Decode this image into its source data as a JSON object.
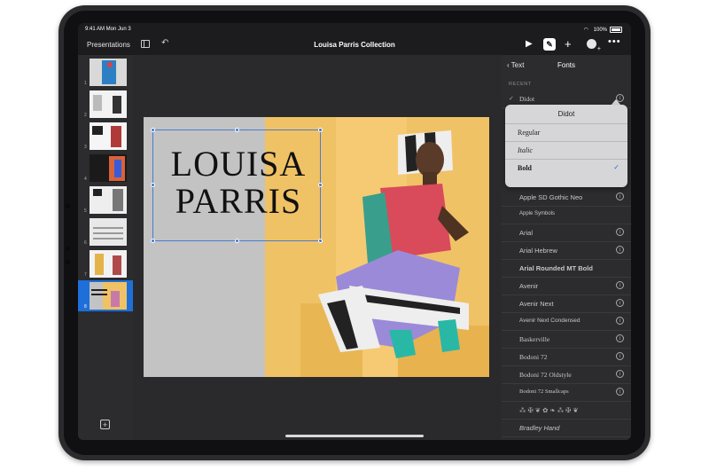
{
  "status_bar": {
    "time": "9:41 AM  Mon Jun 3",
    "battery": "100%"
  },
  "toolbar": {
    "back_label": "Presentations",
    "title": "Louisa Parris Collection",
    "play_icon": "play-icon",
    "format_icon": "paintbrush-icon",
    "add_icon": "plus-icon",
    "collaborate_icon": "collaborate-icon",
    "more_icon": "more-icon"
  },
  "navigator": {
    "slides": [
      {
        "number": "1"
      },
      {
        "number": "2"
      },
      {
        "number": "3"
      },
      {
        "number": "4"
      },
      {
        "number": "5"
      },
      {
        "number": "6"
      },
      {
        "number": "7"
      },
      {
        "number": "8",
        "selected": true
      }
    ],
    "add_icon": "add-slide-icon"
  },
  "slide": {
    "title_line1": "LOUISA",
    "title_line2": "PARRIS"
  },
  "fonts_panel": {
    "back_label": "Text",
    "title": "Fonts",
    "recent_label": "RECENT",
    "recent_font": "Didot",
    "fonts": [
      "Apple SD Gothic Neo",
      "Apple Symbols",
      "Arial",
      "Arial Hebrew",
      "Arial Rounded MT Bold",
      "Avenir",
      "Avenir Next",
      "Avenir Next Condensed",
      "Baskerville",
      "Bodoni 72",
      "Bodoni 72 Oldstyle",
      "Bodoni 72 Smallcaps",
      "Bradley Hand"
    ]
  },
  "popup": {
    "title": "Didot",
    "styles": [
      "Regular",
      "Italic",
      "Bold"
    ],
    "selected": "Bold"
  }
}
